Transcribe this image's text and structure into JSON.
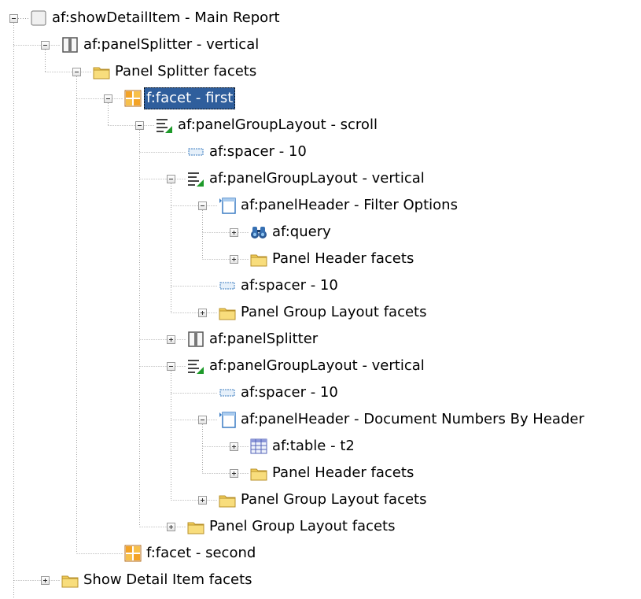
{
  "tree": {
    "selected_label": "f:facet - first",
    "nodes": [
      {
        "label": "af:showDetailItem - Main Report",
        "icon": "page-icon",
        "level": 0,
        "toggle": "expanded"
      },
      {
        "label": "af:panelSplitter - vertical",
        "icon": "splitter-icon",
        "level": 1,
        "toggle": "expanded"
      },
      {
        "label": "Panel Splitter facets",
        "icon": "folder-icon",
        "level": 2,
        "toggle": "expanded"
      },
      {
        "label": "f:facet - first",
        "icon": "facet-icon",
        "level": 3,
        "toggle": "expanded",
        "selected": true
      },
      {
        "label": "af:panelGroupLayout - scroll",
        "icon": "panel-group-layout-icon",
        "level": 4,
        "toggle": "expanded"
      },
      {
        "label": "af:spacer - 10",
        "icon": "spacer-icon",
        "level": 5,
        "toggle": "none"
      },
      {
        "label": "af:panelGroupLayout - vertical",
        "icon": "panel-group-layout-icon",
        "level": 5,
        "toggle": "expanded"
      },
      {
        "label": "af:panelHeader - Filter Options",
        "icon": "panel-header-icon",
        "level": 6,
        "toggle": "expanded"
      },
      {
        "label": "af:query",
        "icon": "binoculars-icon",
        "level": 7,
        "toggle": "collapsed"
      },
      {
        "label": "Panel Header facets",
        "icon": "folder-icon",
        "level": 7,
        "toggle": "collapsed"
      },
      {
        "label": "af:spacer - 10",
        "icon": "spacer-icon",
        "level": 6,
        "toggle": "none"
      },
      {
        "label": "Panel Group Layout facets",
        "icon": "folder-icon",
        "level": 6,
        "toggle": "collapsed"
      },
      {
        "label": "af:panelSplitter",
        "icon": "splitter-icon",
        "level": 5,
        "toggle": "collapsed"
      },
      {
        "label": "af:panelGroupLayout - vertical",
        "icon": "panel-group-layout-icon",
        "level": 5,
        "toggle": "expanded"
      },
      {
        "label": "af:spacer - 10",
        "icon": "spacer-icon",
        "level": 6,
        "toggle": "none"
      },
      {
        "label": "af:panelHeader - Document Numbers By Header",
        "icon": "panel-header-icon",
        "level": 6,
        "toggle": "expanded"
      },
      {
        "label": "af:table - t2",
        "icon": "table-icon",
        "level": 7,
        "toggle": "collapsed"
      },
      {
        "label": "Panel Header facets",
        "icon": "folder-icon",
        "level": 7,
        "toggle": "collapsed"
      },
      {
        "label": "Panel Group Layout facets",
        "icon": "folder-icon",
        "level": 6,
        "toggle": "collapsed"
      },
      {
        "label": "Panel Group Layout facets",
        "icon": "folder-icon",
        "level": 5,
        "toggle": "collapsed"
      },
      {
        "label": "f:facet - second",
        "icon": "facet-icon",
        "level": 3,
        "toggle": "none"
      },
      {
        "label": "Show Detail Item facets",
        "icon": "folder-icon",
        "level": 1,
        "toggle": "collapsed"
      }
    ]
  }
}
